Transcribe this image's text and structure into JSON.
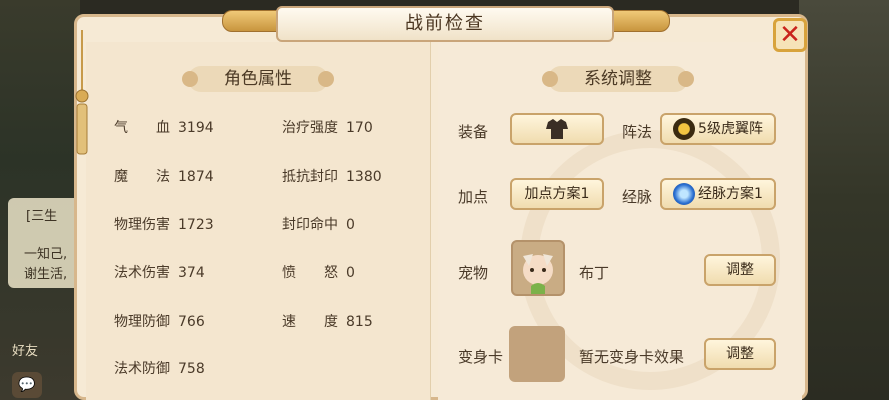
{
  "window": {
    "title": "战前检查"
  },
  "background": {
    "chat_lines": [
      "[三生",
      "一知己,",
      "谢生活,"
    ],
    "friend_label": "好友"
  },
  "left_section": {
    "header": "角色属性",
    "stats": [
      {
        "label": "气　　血",
        "value": "3194"
      },
      {
        "label": "治疗强度",
        "value": "170"
      },
      {
        "label": "魔　　法",
        "value": "1874"
      },
      {
        "label": "抵抗封印",
        "value": "1380"
      },
      {
        "label": "物理伤害",
        "value": "1723"
      },
      {
        "label": "封印命中",
        "value": "0"
      },
      {
        "label": "法术伤害",
        "value": "374"
      },
      {
        "label": "愤　　怒",
        "value": "0"
      },
      {
        "label": "物理防御",
        "value": "766"
      },
      {
        "label": "速　　度",
        "value": "815"
      },
      {
        "label": "法术防御",
        "value": "758"
      }
    ]
  },
  "right_section": {
    "header": "系统调整",
    "equipment_label": "装备",
    "formation_label": "阵法",
    "formation_value": "5级虎翼阵",
    "points_label": "加点",
    "points_value": "加点方案1",
    "meridian_label": "经脉",
    "meridian_value": "经脉方案1",
    "pet_label": "宠物",
    "pet_name": "布丁",
    "pet_adjust": "调整",
    "morph_label": "变身卡",
    "morph_value": "暂无变身卡效果",
    "morph_adjust": "调整"
  },
  "colors": {
    "panel_bg": "#f6ead5",
    "border": "#d7b78c",
    "text": "#4a3a29",
    "close_red": "#c9241c"
  }
}
